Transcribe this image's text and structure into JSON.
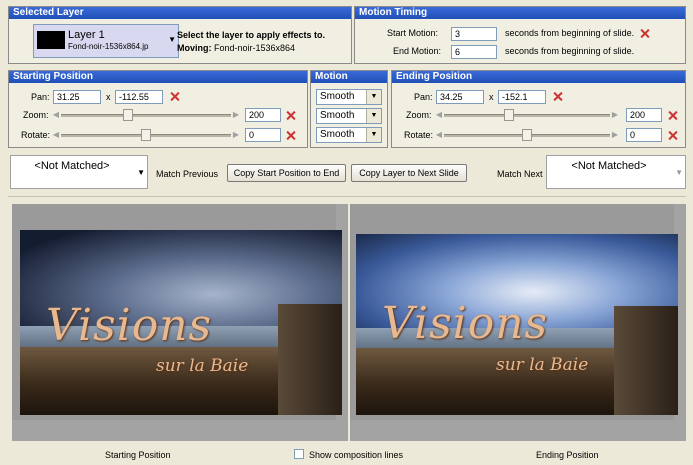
{
  "selected_layer": {
    "title": "Selected Layer",
    "layer_name": "Layer  1",
    "layer_file": "Fond-noir-1536x864.jp",
    "instruction": "Select the layer to apply effects to.",
    "moving_label": "Moving:",
    "moving_value": "Fond-noir-1536x864"
  },
  "motion_timing": {
    "title": "Motion Timing",
    "start_label": "Start Motion:",
    "start_value": "3",
    "start_suffix": "seconds from beginning of slide.",
    "end_label": "End Motion:",
    "end_value": "6",
    "end_suffix": "seconds from beginning of slide."
  },
  "starting_position": {
    "title": "Starting Position",
    "pan_label": "Pan:",
    "pan_x": "31.25",
    "pan_sep": "x",
    "pan_y": "-112.55",
    "zoom_label": "Zoom:",
    "zoom_value": "200",
    "rotate_label": "Rotate:",
    "rotate_value": "0"
  },
  "motion": {
    "title": "Motion",
    "pan": "Smooth",
    "zoom": "Smooth",
    "rotate": "Smooth"
  },
  "ending_position": {
    "title": "Ending Position",
    "pan_label": "Pan:",
    "pan_x": "34.25",
    "pan_sep": "x",
    "pan_y": "-152.1",
    "zoom_label": "Zoom:",
    "zoom_value": "200",
    "rotate_label": "Rotate:",
    "rotate_value": "0"
  },
  "toolbar": {
    "match_prev_value": "<Not Matched>",
    "match_prev_label": "Match Previous",
    "copy_start_label": "Copy Start Position to End",
    "copy_layer_label": "Copy Layer to Next Slide",
    "match_next_label": "Match Next",
    "match_next_value": "<Not Matched>"
  },
  "preview": {
    "title_main": "Visions",
    "title_sub": "sur la Baie",
    "start_caption": "Starting Position",
    "end_caption": "Ending Position",
    "composition_label": "Show composition lines",
    "composition_checked": false
  },
  "colors": {
    "title_bar": "#2558c6",
    "panel_bg": "#f1efe2",
    "window_bg": "#ece9d8",
    "remove_icon": "#cc3333",
    "layer_selected": "#d8d8f0"
  }
}
